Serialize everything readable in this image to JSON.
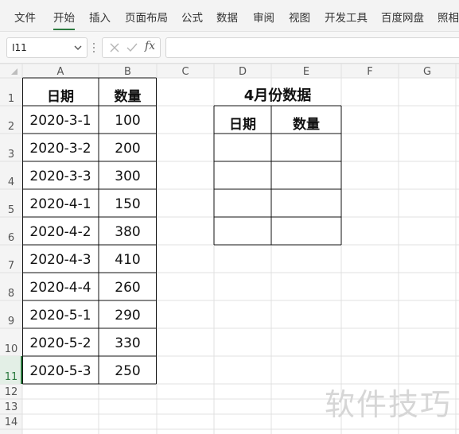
{
  "menu": {
    "items": [
      "文件",
      "开始",
      "插入",
      "页面布局",
      "公式",
      "数据",
      "审阅",
      "视图",
      "开发工具",
      "百度网盘",
      "照相"
    ],
    "active_index": 1,
    "accent_color": "#2c7a3f"
  },
  "formula_bar": {
    "cell_ref": "I11",
    "fx_label": "fx",
    "formula": ""
  },
  "sheet": {
    "columns": [
      "A",
      "B",
      "C",
      "D",
      "E",
      "F",
      "G"
    ],
    "rows": [
      "1",
      "2",
      "3",
      "4",
      "5",
      "6",
      "7",
      "8",
      "9",
      "10",
      "11",
      "12",
      "13",
      "14"
    ],
    "source_table": {
      "headers": [
        "日期",
        "数量"
      ],
      "rows": [
        [
          "2020-3-1",
          "100"
        ],
        [
          "2020-3-2",
          "200"
        ],
        [
          "2020-3-3",
          "300"
        ],
        [
          "2020-4-1",
          "150"
        ],
        [
          "2020-4-2",
          "380"
        ],
        [
          "2020-4-3",
          "410"
        ],
        [
          "2020-4-4",
          "260"
        ],
        [
          "2020-5-1",
          "290"
        ],
        [
          "2020-5-2",
          "330"
        ],
        [
          "2020-5-3",
          "250"
        ]
      ]
    },
    "result_table": {
      "title": "4月份数据",
      "headers": [
        "日期",
        "数量"
      ],
      "rows": [
        [
          "",
          ""
        ],
        [
          "",
          ""
        ],
        [
          "",
          ""
        ],
        [
          "",
          ""
        ]
      ]
    },
    "selected_row": "11"
  },
  "watermark": "软件技巧"
}
